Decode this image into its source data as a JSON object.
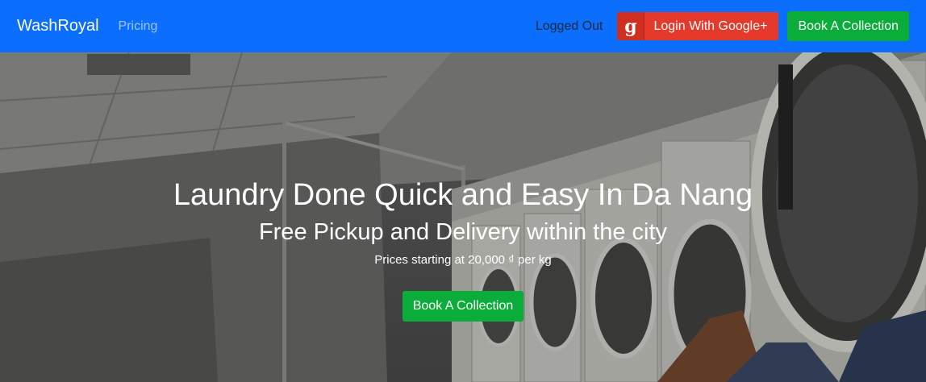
{
  "navbar": {
    "brand": "WashRoyal",
    "links": [
      {
        "label": "Pricing"
      }
    ],
    "status": "Logged Out",
    "google_button": {
      "icon_glyph": "g",
      "label": "Login With Google+"
    },
    "book_button": {
      "label": "Book A Collection"
    },
    "colors": {
      "background": "#0b6efd",
      "google": "#e53a2b",
      "book": "#0aad39"
    }
  },
  "hero": {
    "title": "Laundry Done Quick and Easy In Da Nang",
    "subtitle": "Free Pickup and Delivery within the city",
    "price_text": "Prices starting at 20,000 ₫ per kg",
    "cta_label": "Book A Collection"
  }
}
